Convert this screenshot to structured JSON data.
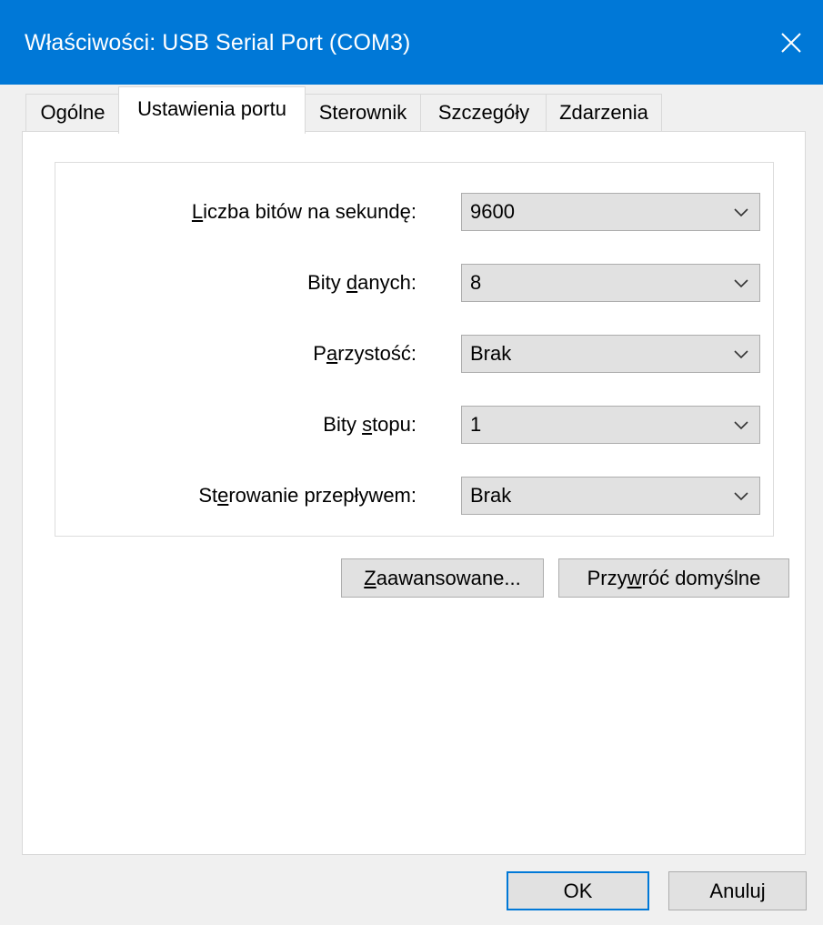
{
  "window": {
    "title": "Właściwości: USB Serial Port (COM3)",
    "accent_color": "#0078d7",
    "close_icon": "close-icon"
  },
  "tabs": [
    {
      "label": "Ogólne",
      "active": false
    },
    {
      "label": "Ustawienia portu",
      "active": true
    },
    {
      "label": "Sterownik",
      "active": false
    },
    {
      "label": "Szczegóły",
      "active": false
    },
    {
      "label": "Zdarzenia",
      "active": false
    }
  ],
  "port_settings": {
    "fields": [
      {
        "label_pre": "",
        "label_key": "L",
        "label_post": "iczba bitów na sekundę:",
        "value": "9600"
      },
      {
        "label_pre": "Bity ",
        "label_key": "d",
        "label_post": "anych:",
        "value": "8"
      },
      {
        "label_pre": "P",
        "label_key": "a",
        "label_post": "rzystość:",
        "value": "Brak"
      },
      {
        "label_pre": "Bity ",
        "label_key": "s",
        "label_post": "topu:",
        "value": "1"
      },
      {
        "label_pre": "St",
        "label_key": "e",
        "label_post": "rowanie przepływem:",
        "value": "Brak"
      }
    ],
    "advanced_button": {
      "pre": "",
      "key": "Z",
      "post": "aawansowane..."
    },
    "restore_button": {
      "pre": "Przy",
      "key": "w",
      "post": "róć domyślne"
    }
  },
  "footer": {
    "ok_label": "OK",
    "cancel_label": "Anuluj"
  }
}
